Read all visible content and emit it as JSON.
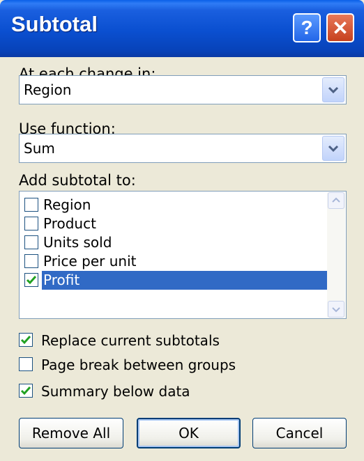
{
  "window": {
    "title": "Subtotal"
  },
  "labels": {
    "at_each_change": "At each change in:",
    "use_function": "Use function:",
    "add_subtotal": "Add subtotal to:"
  },
  "at_each_change_value": "Region",
  "use_function_value": "Sum",
  "subtotal_fields": [
    {
      "label": "Region",
      "checked": false,
      "selected": false
    },
    {
      "label": "Product",
      "checked": false,
      "selected": false
    },
    {
      "label": "Units sold",
      "checked": false,
      "selected": false
    },
    {
      "label": "Price per unit",
      "checked": false,
      "selected": false
    },
    {
      "label": "Profit",
      "checked": true,
      "selected": true
    }
  ],
  "options": {
    "replace_current": {
      "label": "Replace current subtotals",
      "checked": true
    },
    "page_break": {
      "label": "Page break between groups",
      "checked": false
    },
    "summary_below": {
      "label": "Summary below data",
      "checked": true
    }
  },
  "buttons": {
    "remove_all": "Remove All",
    "ok": "OK",
    "cancel": "Cancel"
  },
  "icons": {
    "help": "help-icon",
    "close": "close-icon",
    "dropdown": "chevron-down-icon",
    "check": "check-icon"
  },
  "colors": {
    "title_bar": "#0a4fd0",
    "selection": "#316ac5",
    "dialog_bg": "#ece9d8",
    "check": "#21a121"
  }
}
